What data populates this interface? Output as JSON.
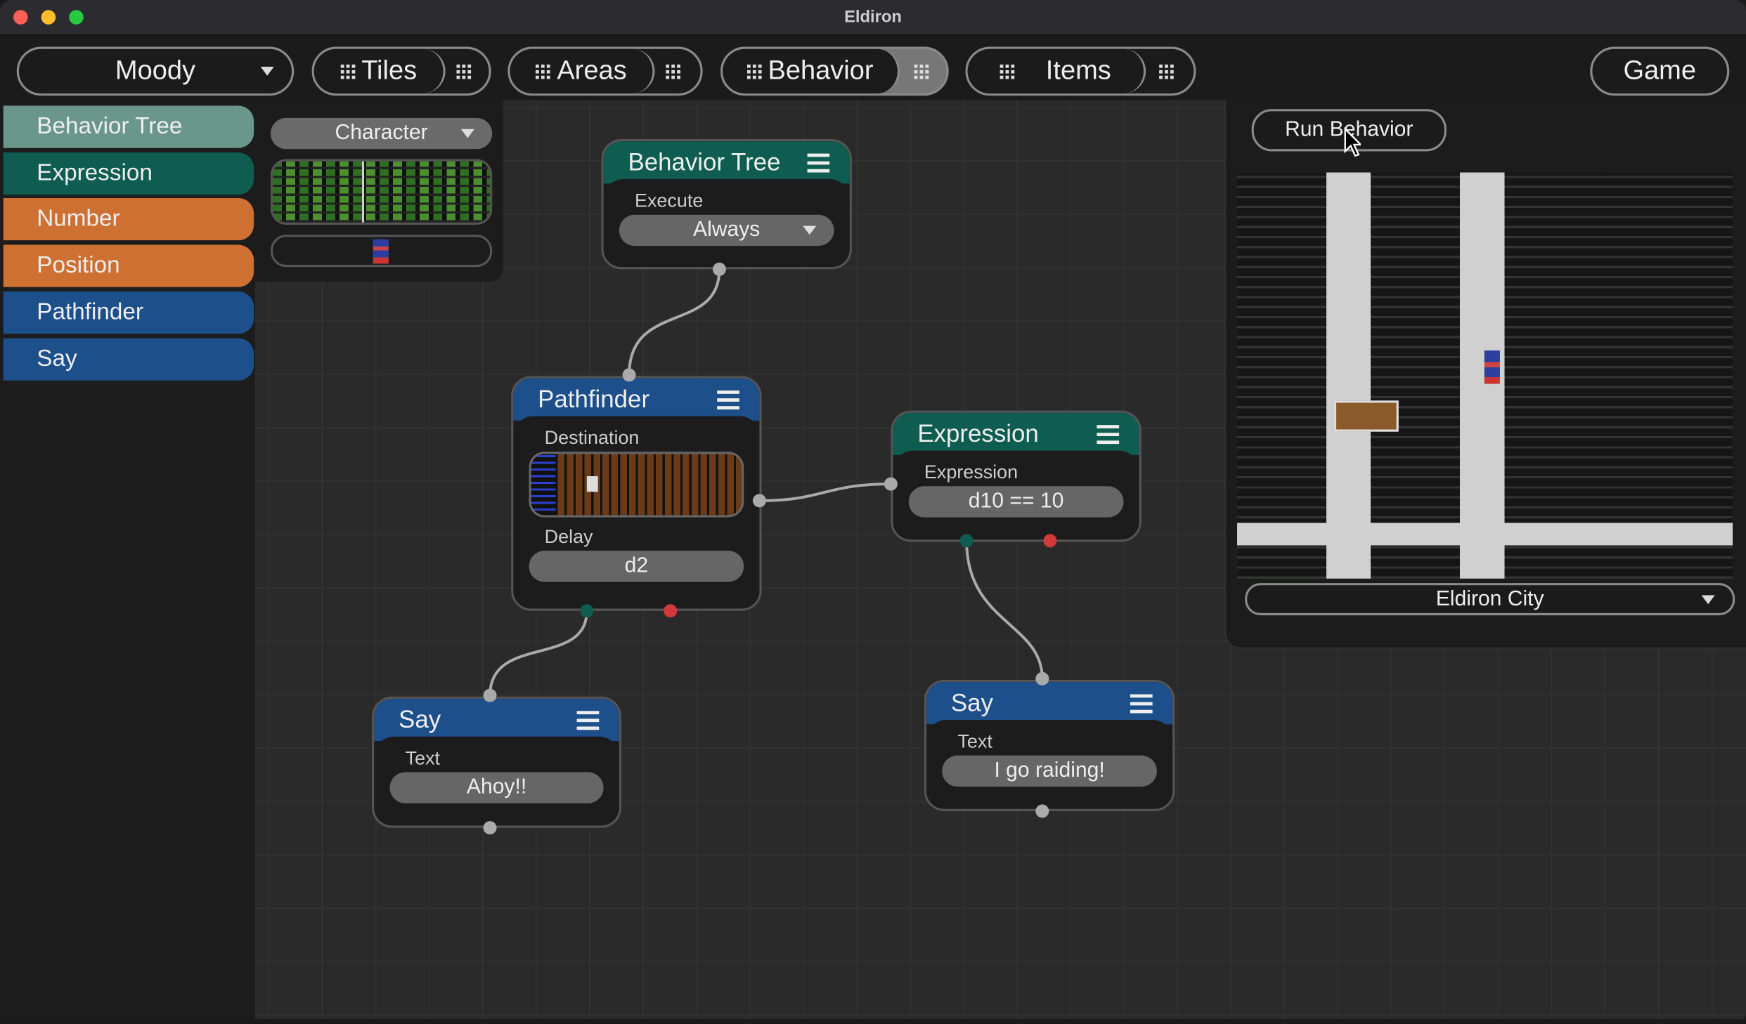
{
  "window": {
    "title": "Eldiron"
  },
  "toolbar": {
    "project": "Moody",
    "tabs": [
      {
        "label": "Tiles"
      },
      {
        "label": "Areas"
      },
      {
        "label": "Behavior",
        "active": true
      },
      {
        "label": "Items"
      }
    ],
    "game": "Game"
  },
  "sidebar": {
    "items": [
      {
        "label": "Behavior Tree",
        "color": "#6b968b"
      },
      {
        "label": "Expression",
        "color": "#0f5c50"
      },
      {
        "label": "Number",
        "color": "#cf7033"
      },
      {
        "label": "Position",
        "color": "#cf7033"
      },
      {
        "label": "Pathfinder",
        "color": "#1d4f8b"
      },
      {
        "label": "Say",
        "color": "#1d4f8b"
      }
    ]
  },
  "character_panel": {
    "type": "Character"
  },
  "nodes": {
    "behavior_tree": {
      "title": "Behavior Tree",
      "label": "Execute",
      "value": "Always"
    },
    "pathfinder": {
      "title": "Pathfinder",
      "label1": "Destination",
      "label2": "Delay",
      "value2": "d2"
    },
    "expression": {
      "title": "Expression",
      "label": "Expression",
      "value": "d10 == 10"
    },
    "say1": {
      "title": "Say",
      "label": "Text",
      "value": "Ahoy!!"
    },
    "say2": {
      "title": "Say",
      "label": "Text",
      "value": "I go raiding!"
    }
  },
  "preview": {
    "run_button": "Run Behavior",
    "area": "Eldiron City"
  },
  "colors": {
    "teal": "#0f5c50",
    "blue": "#1d4f8b",
    "orange": "#cf7033",
    "success_out": "#0f5c50",
    "fail_out": "#d23a3a"
  }
}
